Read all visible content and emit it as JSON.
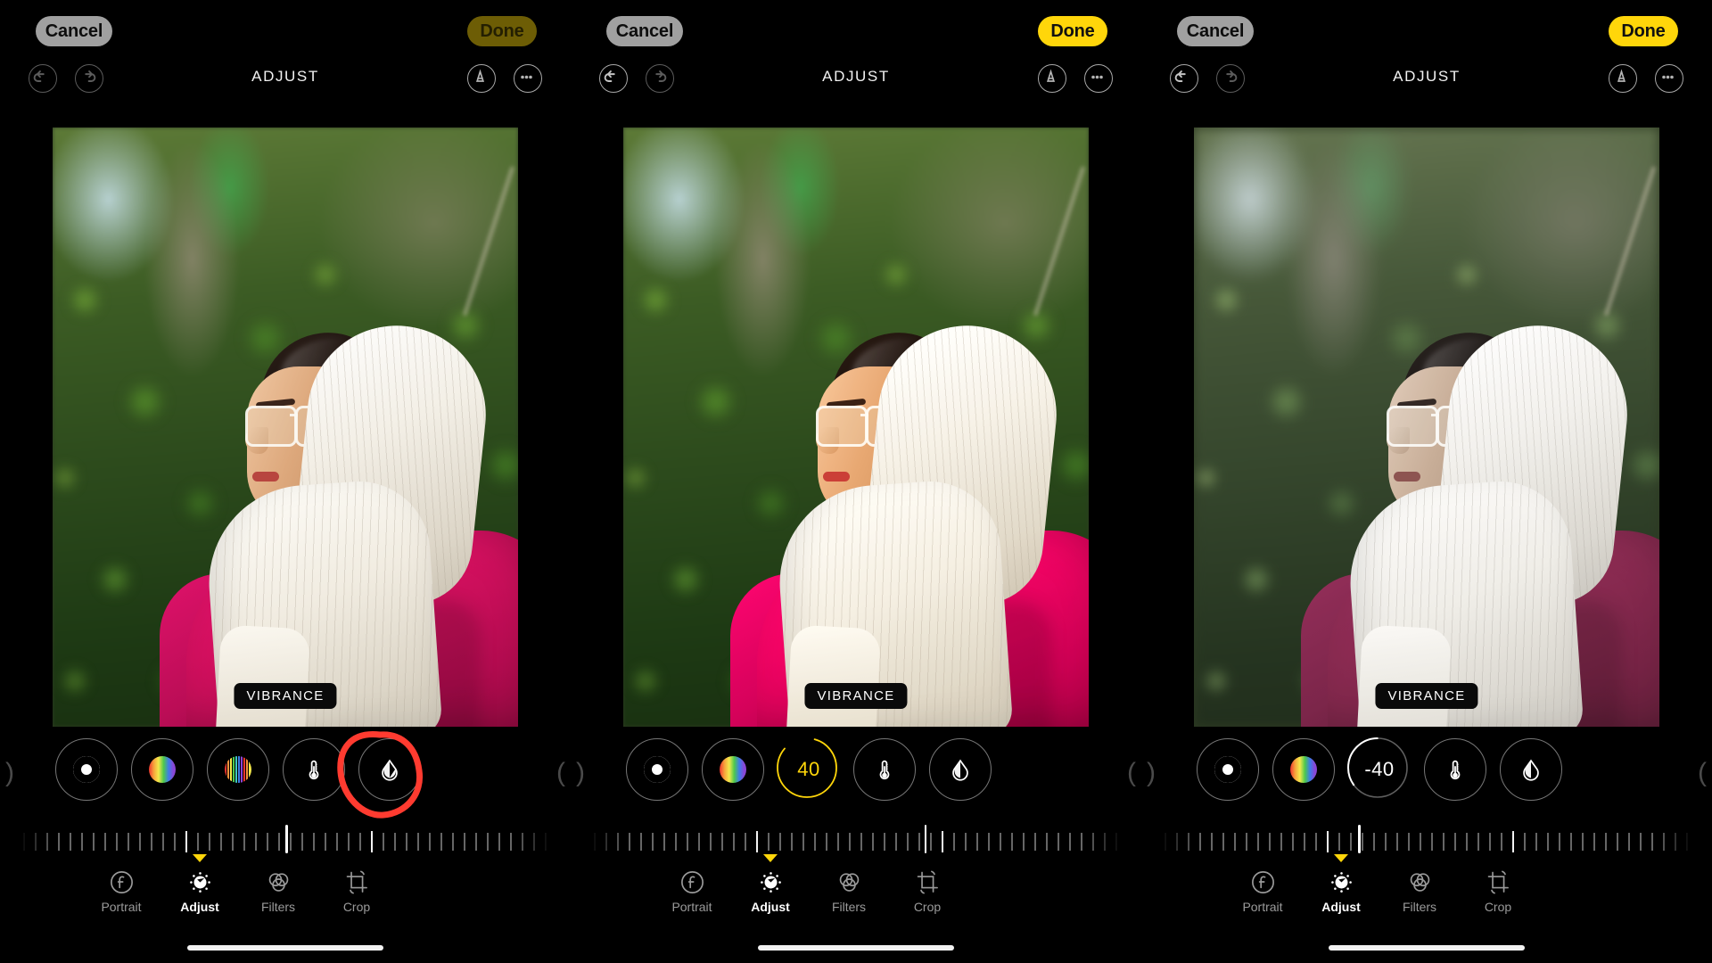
{
  "app": {
    "screen_title": "ADJUST",
    "adjustment_label": "VIBRANCE"
  },
  "top_bar": {
    "cancel_label": "Cancel",
    "done_label": "Done",
    "undo_icon": "undo-arrow-icon",
    "redo_icon": "redo-arrow-icon",
    "markup_icon": "markup-pen-icon",
    "more_icon": "more-ellipsis-icon"
  },
  "adjust_tools": [
    {
      "name": "brilliance",
      "icon": "brilliance-donut-icon"
    },
    {
      "name": "saturation",
      "icon": "saturation-gradient-icon"
    },
    {
      "name": "vibrance",
      "icon": "vibrance-stripes-icon"
    },
    {
      "name": "warmth",
      "icon": "warmth-thermometer-icon"
    },
    {
      "name": "tint",
      "icon": "tint-droplet-icon"
    }
  ],
  "tabs": [
    {
      "label": "Portrait",
      "icon": "portrait-f-icon",
      "active": false
    },
    {
      "label": "Adjust",
      "icon": "adjust-dial-icon",
      "active": true
    },
    {
      "label": "Filters",
      "icon": "filters-circles-icon",
      "active": false
    },
    {
      "label": "Crop",
      "icon": "crop-rotate-icon",
      "active": false
    }
  ],
  "panels": [
    {
      "id": "panel-1",
      "state": "unchanged",
      "done_enabled": false,
      "undo_enabled": false,
      "vibrance_value": null,
      "vibrance_display": "",
      "slider_percent": 50,
      "dot_percent": 50,
      "dot_visible": false,
      "annotation": "red-circle-highlight-vibrance"
    },
    {
      "id": "panel-2",
      "state": "vibrance increased",
      "done_enabled": true,
      "undo_enabled": true,
      "vibrance_value": 40,
      "vibrance_display": "40",
      "slider_percent": 62,
      "dot_percent": 47,
      "dot_visible": true,
      "annotation": null
    },
    {
      "id": "panel-3",
      "state": "vibrance decreased",
      "done_enabled": true,
      "undo_enabled": true,
      "vibrance_value": -40,
      "vibrance_display": "-40",
      "slider_percent": 38,
      "dot_percent": 53,
      "dot_visible": true,
      "annotation": null
    }
  ],
  "colors": {
    "accent_yellow": "#ffd60a",
    "done_disabled": "#6d5d05",
    "cancel_gray": "#a0a0a0",
    "annotation_red": "#ff3b30",
    "background": "#000000"
  }
}
